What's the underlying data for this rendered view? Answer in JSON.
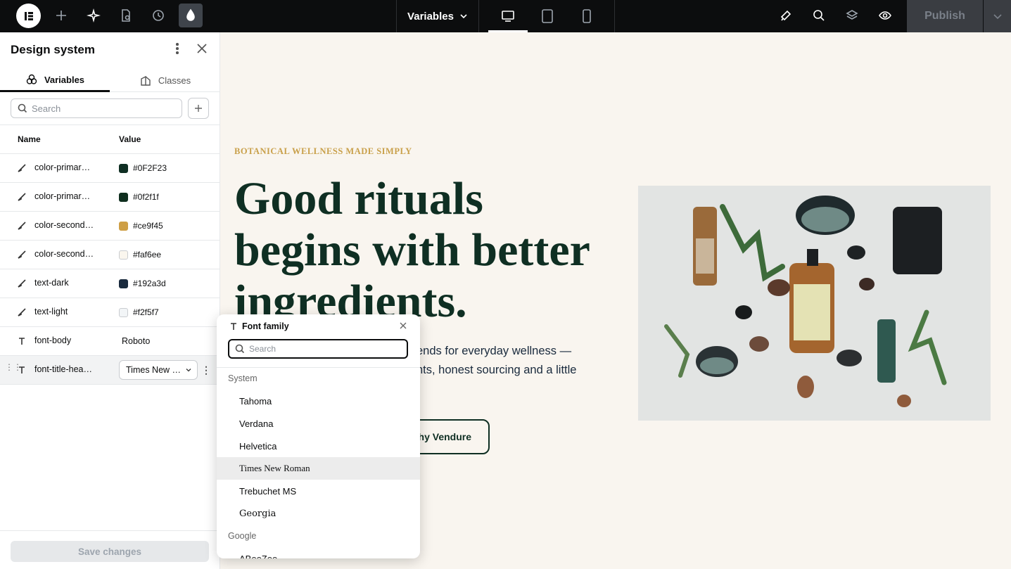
{
  "topbar": {
    "variables_label": "Variables",
    "publish_label": "Publish"
  },
  "panel": {
    "title": "Design system",
    "tabs": [
      {
        "label": "Variables",
        "active": true
      },
      {
        "label": "Classes",
        "active": false
      }
    ],
    "search_placeholder": "Search",
    "columns": {
      "name": "Name",
      "value": "Value"
    },
    "variables": [
      {
        "type": "color",
        "name": "color-primar…",
        "value": "#0F2F23",
        "swatch": "#0F2F23"
      },
      {
        "type": "color",
        "name": "color-primar…",
        "value": "#0f2f1f",
        "swatch": "#0f2f1f"
      },
      {
        "type": "color",
        "name": "color-second…",
        "value": "#ce9f45",
        "swatch": "#ce9f45"
      },
      {
        "type": "color",
        "name": "color-second…",
        "value": "#faf6ee",
        "swatch": "#faf6ee"
      },
      {
        "type": "color",
        "name": "text-dark",
        "value": "#192a3d",
        "swatch": "#192a3d"
      },
      {
        "type": "color",
        "name": "text-light",
        "value": "#f2f5f7",
        "swatch": "#f2f5f7"
      },
      {
        "type": "font",
        "name": "font-body",
        "value": "Roboto"
      },
      {
        "type": "font",
        "name": "font-title-hea…",
        "value": "Times New …"
      }
    ],
    "save_label": "Save changes"
  },
  "hero": {
    "eyebrow": "BOTANICAL WELLNESS MADE SIMPLY",
    "title": "Good rituals begins with better ingredients.",
    "body_line1": "ends for everyday wellness —",
    "body_line2": "nts, honest sourcing and a little",
    "cta": "hy Vendure"
  },
  "font_popup": {
    "title": "Font family",
    "search_placeholder": "Search",
    "group_system": "System",
    "system_fonts": [
      "Tahoma",
      "Verdana",
      "Helvetica",
      "Times New Roman",
      "Trebuchet MS",
      "Georgia"
    ],
    "highlighted": "Times New Roman",
    "group_google": "Google",
    "google_fonts": [
      "ABeeZee"
    ]
  },
  "colors": {
    "dark_green": "#0f2f23",
    "gold": "#ce9f45",
    "canvas_bg": "#f9f5ef",
    "topbar_bg": "#0c0d0e"
  }
}
